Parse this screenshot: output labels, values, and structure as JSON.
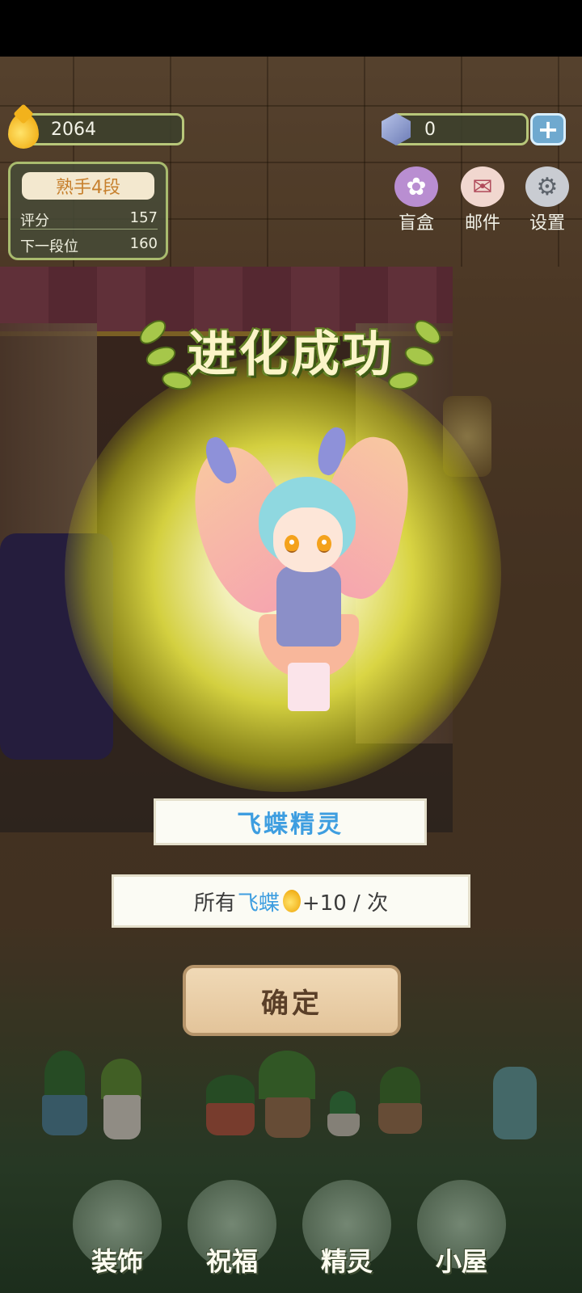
{
  "hud": {
    "drops_value": "2064",
    "gems_value": "0",
    "plus_label": "+"
  },
  "rank": {
    "title": "熟手4段",
    "score_label": "评分",
    "score_value": "157",
    "next_label": "下一段位",
    "next_value": "160"
  },
  "top_menu": [
    {
      "label": "盲盒",
      "icon": "blind-box-icon"
    },
    {
      "label": "邮件",
      "icon": "mail-icon"
    },
    {
      "label": "设置",
      "icon": "gear-icon"
    }
  ],
  "popup": {
    "title": "进化成功",
    "creature_name": "飞蝶精灵",
    "desc_prefix": "所有",
    "desc_highlight": "飞蝶",
    "desc_suffix": "+10 / 次",
    "confirm_label": "确定"
  },
  "bottom_nav": [
    {
      "label": "装饰",
      "icon": "plant-icon"
    },
    {
      "label": "祝福",
      "icon": "butterfly-icon"
    },
    {
      "label": "精灵",
      "icon": "fairy-icon"
    },
    {
      "label": "小屋",
      "icon": "house-icon"
    }
  ],
  "colors": {
    "accent_blue": "#3e9ee0",
    "glow_yellow": "#f0ee46",
    "title_text": "#fbf4c8"
  }
}
